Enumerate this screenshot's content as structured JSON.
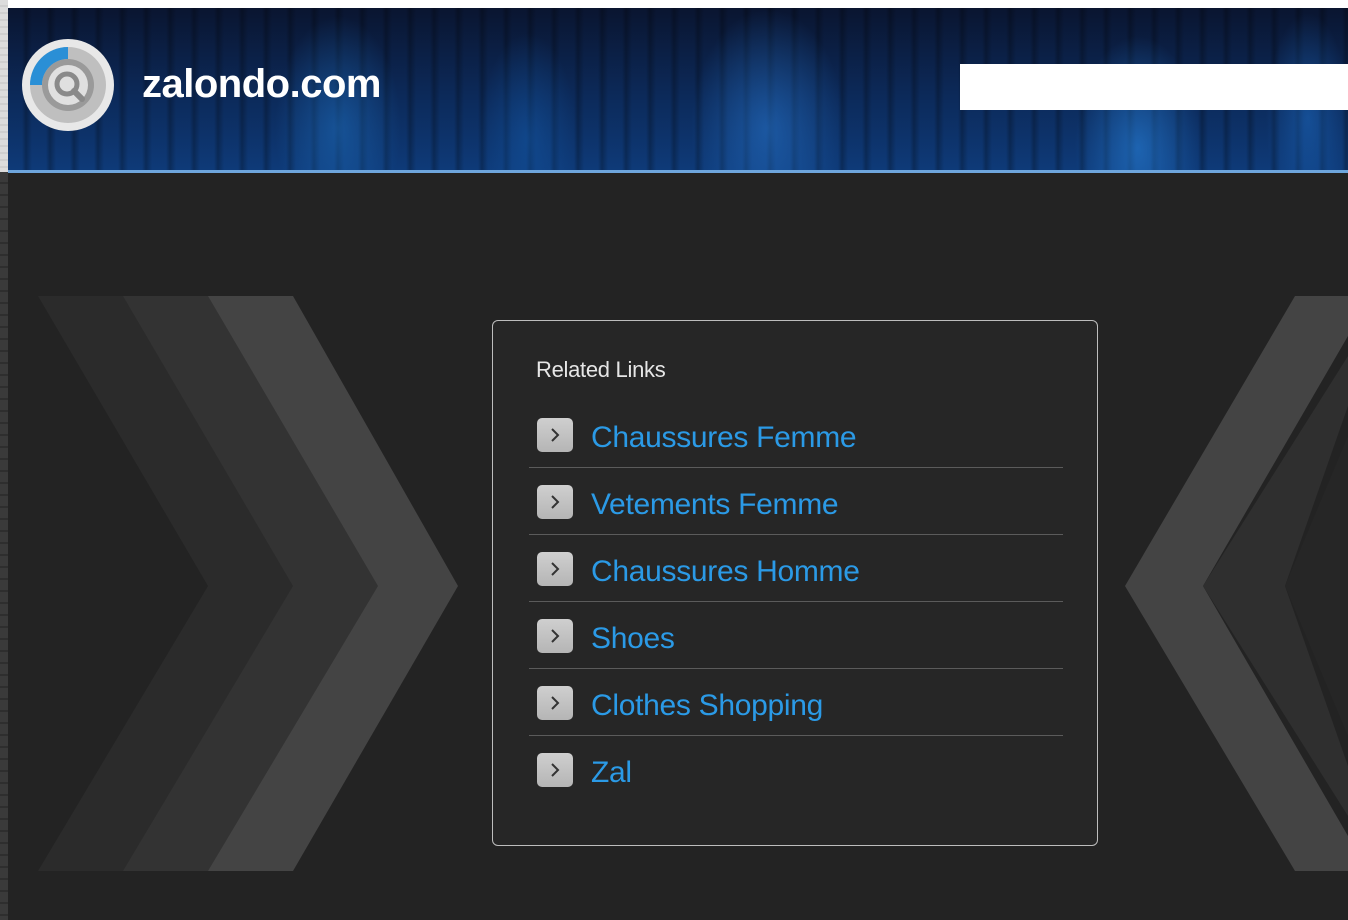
{
  "header": {
    "site_name": "zalondo.com",
    "logo_icon": "ring-search-logo-icon",
    "search": {
      "value": "",
      "placeholder": ""
    }
  },
  "related": {
    "title": "Related Links",
    "link_icon": "chevron-right-icon",
    "items": [
      {
        "label": "Chaussures Femme"
      },
      {
        "label": "Vetements Femme"
      },
      {
        "label": "Chaussures Homme"
      },
      {
        "label": "Shoes"
      },
      {
        "label": "Clothes Shopping"
      },
      {
        "label": "Zal"
      }
    ]
  },
  "colors": {
    "link": "#2b9ae6",
    "background": "#232323",
    "header_accent": "#6ea6dd"
  }
}
